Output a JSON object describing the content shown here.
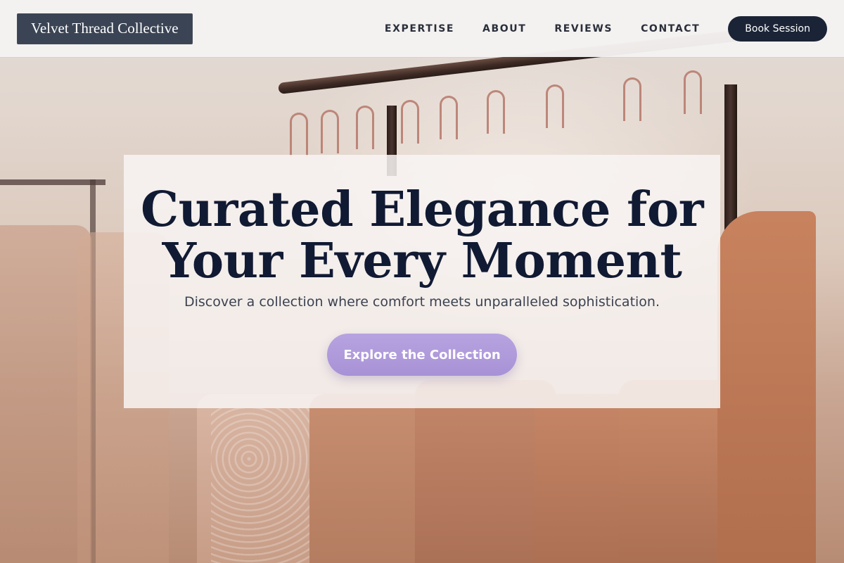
{
  "header": {
    "brand": "Velvet Thread Collective",
    "nav": [
      {
        "label": "EXPERTISE"
      },
      {
        "label": "ABOUT"
      },
      {
        "label": "REVIEWS"
      },
      {
        "label": "CONTACT"
      }
    ],
    "book_button": "Book Session"
  },
  "hero": {
    "title_line1": "Curated Elegance for",
    "title_line2": "Your Every Moment",
    "subtitle": "Discover a collection where comfort meets unparalleled sophistication.",
    "cta_label": "Explore the Collection"
  },
  "colors": {
    "brand_bg": "#3b4454",
    "title": "#111a33",
    "book_button_bg": "#1b2436",
    "cta_bg": "#a892d6"
  }
}
